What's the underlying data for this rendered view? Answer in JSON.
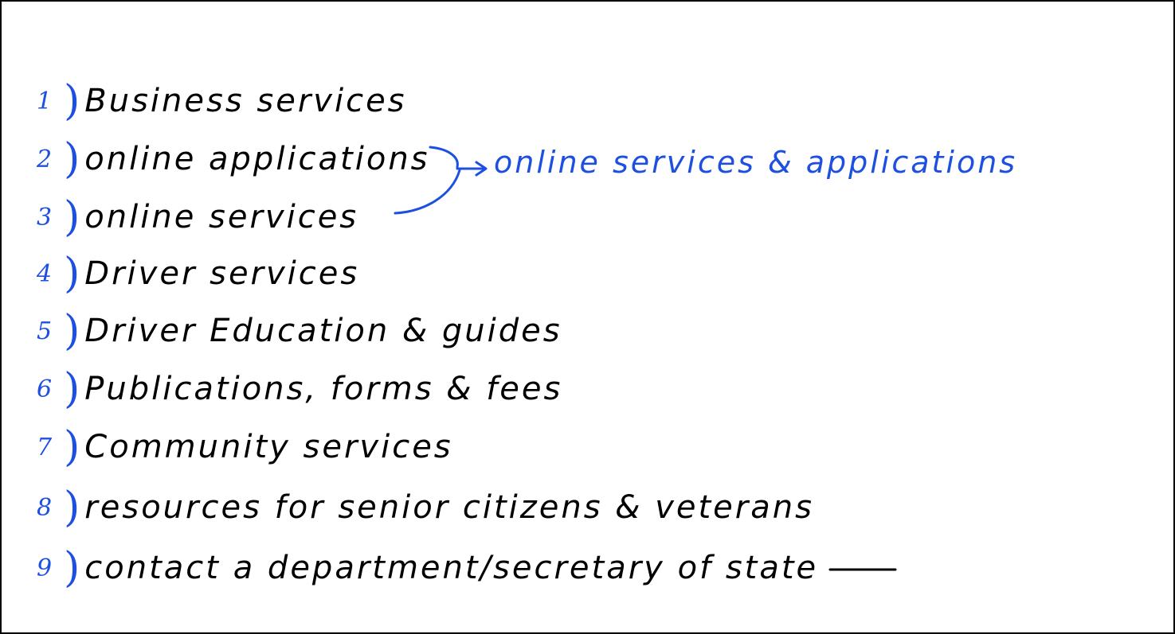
{
  "notes": {
    "items": [
      {
        "number": "1",
        "text": "Business services"
      },
      {
        "number": "2",
        "text": "online applications"
      },
      {
        "number": "3",
        "text": "online services"
      },
      {
        "number": "4",
        "text": "Driver services"
      },
      {
        "number": "5",
        "text": "Driver Education & guides"
      },
      {
        "number": "6",
        "text": "Publications, forms & fees"
      },
      {
        "number": "7",
        "text": "Community services"
      },
      {
        "number": "8",
        "text": "resources for senior citizens & veterans"
      },
      {
        "number": "9",
        "text": "contact a department/secretary of state"
      }
    ],
    "merge_annotation": "online services & applications"
  },
  "colors": {
    "ink_black": "#000000",
    "ink_blue": "#1d4fe0",
    "background": "#ffffff"
  }
}
